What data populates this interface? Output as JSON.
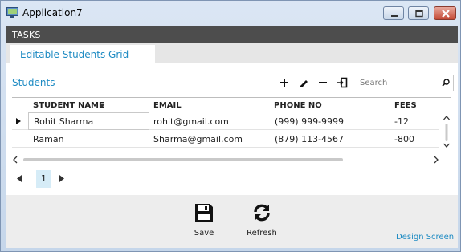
{
  "window": {
    "title": "Application7",
    "icons": [
      "app-icon",
      "minimize-icon",
      "maximize-icon",
      "close-icon"
    ]
  },
  "tasks_bar": {
    "label": "TASKS"
  },
  "tabs": [
    {
      "label": "Editable Students Grid",
      "selected": true
    }
  ],
  "grid": {
    "title": "Students",
    "toolbar_icons": [
      "add-icon",
      "edit-icon",
      "delete-icon",
      "export-icon"
    ],
    "search": {
      "placeholder": "Search",
      "value": ""
    },
    "columns": [
      "STUDENT NAME",
      "EMAIL",
      "PHONE NO",
      "FEES"
    ],
    "sort": {
      "column": "STUDENT NAME",
      "direction": "descending"
    },
    "rows": [
      {
        "name": "Rohit Sharma",
        "email": "rohit@gmail.com",
        "phone": "(999) 999-9999",
        "fees": "-12",
        "current": true
      },
      {
        "name": "Raman",
        "email": "Sharma@gmail.com",
        "phone": "(879) 113-4567",
        "fees": "-800",
        "current": false
      }
    ]
  },
  "pager": {
    "current_page": "1"
  },
  "footer": {
    "save_label": "Save",
    "refresh_label": "Refresh",
    "design_link": "Design Screen"
  },
  "colors": {
    "accent": "#1e8bc3",
    "tasks_bar": "#4d4d4d",
    "selected_page": "#d6ecf7",
    "close_button": "#c44a36"
  }
}
